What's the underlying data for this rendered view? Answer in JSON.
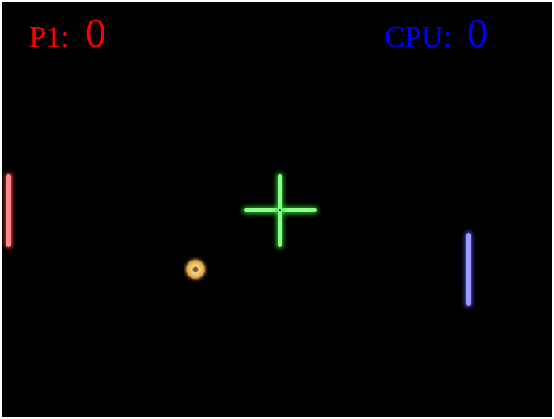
{
  "scoreboard": {
    "player": {
      "label": "P1:",
      "score": "0",
      "color": "#ff0000"
    },
    "cpu": {
      "label": "CPU:",
      "score": "0",
      "color": "#0000ff"
    }
  },
  "colors": {
    "court_background": "#000000",
    "left_paddle": "#ff8a8a",
    "right_paddle": "#9a9aff",
    "crosshair": "#8cff8c",
    "ball": "#e7b95a"
  },
  "icons": {
    "center": "crosshair-icon",
    "ball": "ball-icon"
  }
}
